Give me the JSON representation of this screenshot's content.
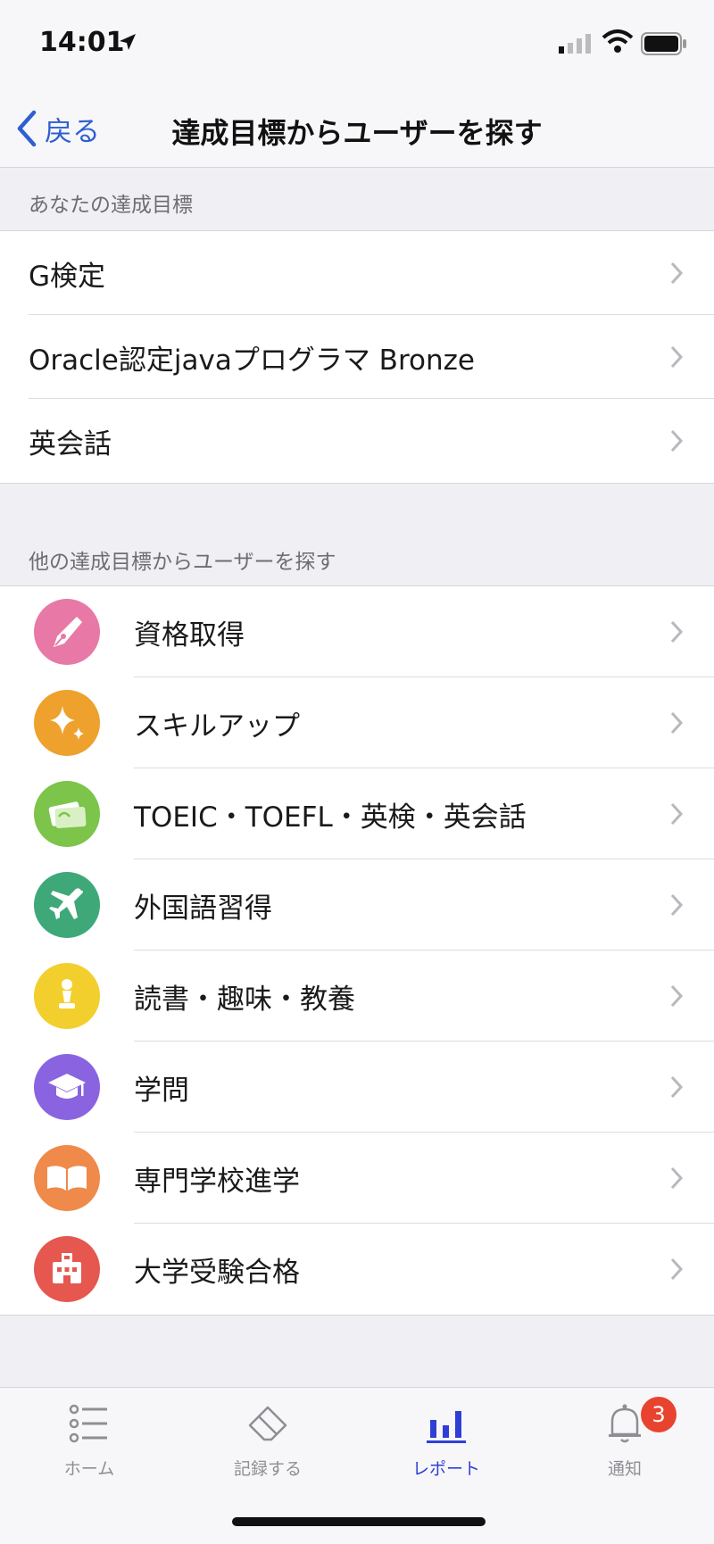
{
  "status_bar": {
    "time": "14:01"
  },
  "nav": {
    "back_label": "戻る",
    "title": "達成目標からユーザーを探す"
  },
  "your_goals": {
    "header": "あなたの達成目標",
    "items": [
      {
        "label": "G検定"
      },
      {
        "label": "Oracle認定javaプログラマ Bronze"
      },
      {
        "label": "英会話"
      }
    ]
  },
  "other_goals": {
    "header": "他の達成目標からユーザーを探す",
    "items": [
      {
        "label": "資格取得",
        "icon": "pen-nib-icon",
        "color": "#e879a6"
      },
      {
        "label": "スキルアップ",
        "icon": "sparkle-icon",
        "color": "#eea12c"
      },
      {
        "label": "TOEIC・TOEFL・英検・英会話",
        "icon": "card-icon",
        "color": "#7cc44a"
      },
      {
        "label": "外国語習得",
        "icon": "airplane-icon",
        "color": "#3fa878"
      },
      {
        "label": "読書・趣味・教養",
        "icon": "chess-pawn-icon",
        "color": "#f2cf2c"
      },
      {
        "label": "学問",
        "icon": "graduation-cap-icon",
        "color": "#8a64e0"
      },
      {
        "label": "専門学校進学",
        "icon": "open-book-icon",
        "color": "#ef8a4a"
      },
      {
        "label": "大学受験合格",
        "icon": "school-building-icon",
        "color": "#e5574f"
      }
    ]
  },
  "tab_bar": {
    "tabs": [
      {
        "label": "ホーム",
        "icon": "list-icon"
      },
      {
        "label": "記録する",
        "icon": "eraser-icon"
      },
      {
        "label": "レポート",
        "icon": "bar-chart-icon",
        "active": true
      },
      {
        "label": "通知",
        "icon": "bell-icon",
        "badge": "3"
      }
    ]
  },
  "colors": {
    "accent": "#2f5fd0",
    "active_tab": "#2f3fd6",
    "badge": "#e8432f"
  }
}
